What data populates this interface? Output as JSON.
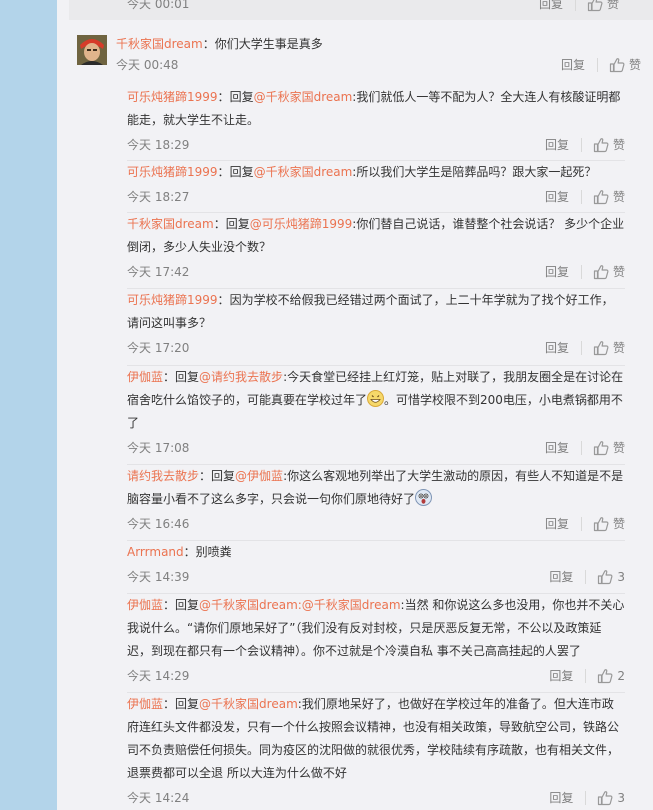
{
  "top": {
    "time": "今天 00:01",
    "reply": "回复",
    "like": "赞"
  },
  "main": {
    "author": "千秋家国dream",
    "sep": "：",
    "text": "你们大学生事是真多",
    "time": "今天 00:48",
    "reply": "回复",
    "like": "赞"
  },
  "replies": [
    {
      "author": "可乐炖猪蹄1999",
      "sep": "：",
      "pre": "回复",
      "mention": "@千秋家国dream",
      "colon": ":",
      "text": "我们就低人一等不配为人？全大连人有核酸证明都能走，就大学生不让走。",
      "time": "今天 18:29",
      "reply": "回复",
      "like": "赞"
    },
    {
      "author": "可乐炖猪蹄1999",
      "sep": "：",
      "pre": "回复",
      "mention": "@千秋家国dream",
      "colon": ":",
      "text": "所以我们大学生是陪葬品吗？跟大家一起死？",
      "time": "今天 18:27",
      "reply": "回复",
      "like": "赞"
    },
    {
      "author": "千秋家国dream",
      "sep": "：",
      "pre": "回复",
      "mention": "@可乐炖猪蹄1999",
      "colon": ":",
      "text": "你们替自己说话，谁替整个社会说话？ 多少个企业倒闭，多少人失业没个数？",
      "time": "今天 17:42",
      "reply": "回复",
      "like": "赞"
    },
    {
      "author": "可乐炖猪蹄1999",
      "sep": "：",
      "pre": "",
      "mention": "",
      "colon": "",
      "text": "因为学校不给假我已经错过两个面试了，上二十年学就为了找个好工作，请问这叫事多？",
      "time": "今天 17:20",
      "reply": "回复",
      "like": "赞"
    },
    {
      "author": "伊伽蓝",
      "sep": "：",
      "pre": "回复",
      "mention": "@请约我去散步",
      "colon": ":",
      "text": "今天食堂已经挂上红灯笼，贴上对联了，我朋友圈全是在讨论在宿舍吃什么馅饺子的，可能真要在学校过年了",
      "emoji": "grin",
      "text2": "。可惜学校限不到200电压，小电煮锅都用不了",
      "time": "今天 17:08",
      "reply": "回复",
      "like": "赞"
    },
    {
      "author": "请约我去散步",
      "sep": "：",
      "pre": "回复",
      "mention": "@伊伽蓝",
      "colon": ":",
      "text": "你这么客观地列举出了大学生激动的原因，有些人不知道是不是脑容量小看不了这么多字，只会说一句你们原地待好了",
      "emoji": "shock",
      "text2": "",
      "time": "今天 16:46",
      "reply": "回复",
      "like": "赞"
    },
    {
      "author": "Arrrmand",
      "sep": "：",
      "pre": "",
      "mention": "",
      "colon": "",
      "text": "别喷粪",
      "time": "今天 14:39",
      "reply": "回复",
      "like": "3"
    },
    {
      "author": "伊伽蓝",
      "sep": "：",
      "pre": "回复",
      "mention": "@千秋家国dream:@千秋家国dream",
      "colon": ":",
      "text": "当然 和你说这么多也没用，你也并不关心我说什么。“请你们原地呆好了”（我们没有反对封校，只是厌恶反复无常，不公以及政策延迟，到现在都只有一个会议精神）。你不过就是个冷漠自私 事不关己高高挂起的人罢了",
      "time": "今天 14:29",
      "reply": "回复",
      "like": "2"
    },
    {
      "author": "伊伽蓝",
      "sep": "：",
      "pre": "回复",
      "mention": "@千秋家国dream",
      "colon": ":",
      "text": "我们原地呆好了，也做好在学校过年的准备了。但大连市政府连红头文件都没发，只有一个什么按照会议精神，也没有相关政策，导致航空公司，铁路公司不负责赔偿任何损失。同为疫区的沈阳做的就很优秀，学校陆续有序疏散，也有相关文件，退票费都可以全退 所以大连为什么做不好",
      "time": "今天 14:24",
      "reply": "回复",
      "like": "3"
    }
  ]
}
